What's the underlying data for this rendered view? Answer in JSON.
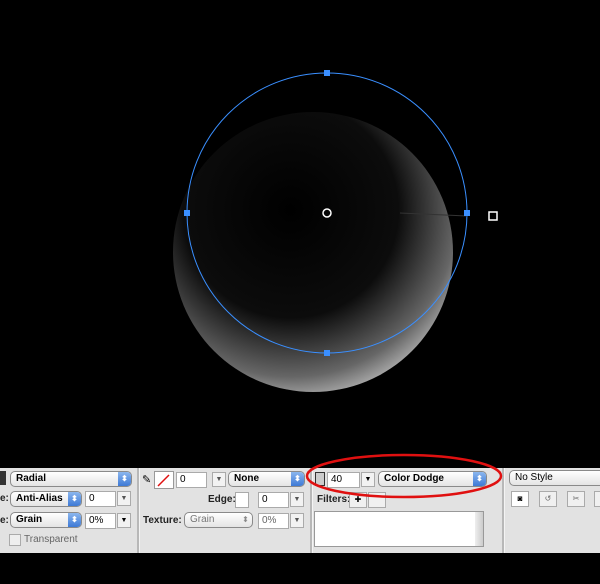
{
  "fill": {
    "type": "Radial",
    "edge": "Anti-Alias",
    "edge_value": "0",
    "texture": "Grain",
    "texture_value": "0%",
    "transparent_label": "Transparent",
    "edge_label_partial": "e:",
    "texture_label_partial": "e:"
  },
  "stroke": {
    "size": "0",
    "type": "None",
    "edge_label": "Edge:",
    "edge_value": "0",
    "texture_label": "Texture:",
    "texture": "Grain",
    "texture_value": "0%"
  },
  "effects": {
    "opacity": "40",
    "blend_mode": "Color Dodge",
    "filters_label": "Filters:"
  },
  "style": {
    "selected": "No Style"
  },
  "colors": {
    "handle": "#3a8fff",
    "annotation": "#e01010"
  }
}
